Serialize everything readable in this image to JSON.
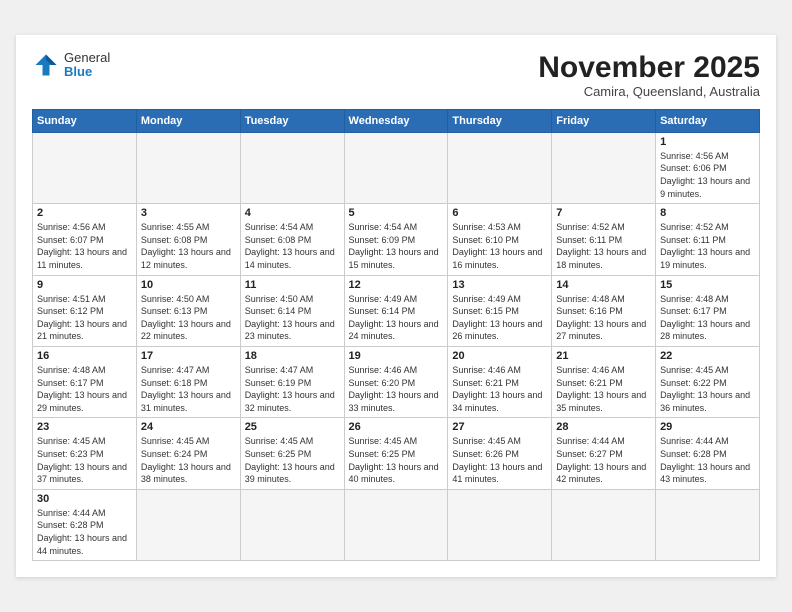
{
  "header": {
    "logo_general": "General",
    "logo_blue": "Blue",
    "month_title": "November 2025",
    "subtitle": "Camira, Queensland, Australia"
  },
  "weekdays": [
    "Sunday",
    "Monday",
    "Tuesday",
    "Wednesday",
    "Thursday",
    "Friday",
    "Saturday"
  ],
  "weeks": [
    [
      {
        "day": "",
        "info": ""
      },
      {
        "day": "",
        "info": ""
      },
      {
        "day": "",
        "info": ""
      },
      {
        "day": "",
        "info": ""
      },
      {
        "day": "",
        "info": ""
      },
      {
        "day": "",
        "info": ""
      },
      {
        "day": "1",
        "info": "Sunrise: 4:56 AM\nSunset: 6:06 PM\nDaylight: 13 hours and 9 minutes."
      }
    ],
    [
      {
        "day": "2",
        "info": "Sunrise: 4:56 AM\nSunset: 6:07 PM\nDaylight: 13 hours and 11 minutes."
      },
      {
        "day": "3",
        "info": "Sunrise: 4:55 AM\nSunset: 6:08 PM\nDaylight: 13 hours and 12 minutes."
      },
      {
        "day": "4",
        "info": "Sunrise: 4:54 AM\nSunset: 6:08 PM\nDaylight: 13 hours and 14 minutes."
      },
      {
        "day": "5",
        "info": "Sunrise: 4:54 AM\nSunset: 6:09 PM\nDaylight: 13 hours and 15 minutes."
      },
      {
        "day": "6",
        "info": "Sunrise: 4:53 AM\nSunset: 6:10 PM\nDaylight: 13 hours and 16 minutes."
      },
      {
        "day": "7",
        "info": "Sunrise: 4:52 AM\nSunset: 6:11 PM\nDaylight: 13 hours and 18 minutes."
      },
      {
        "day": "8",
        "info": "Sunrise: 4:52 AM\nSunset: 6:11 PM\nDaylight: 13 hours and 19 minutes."
      }
    ],
    [
      {
        "day": "9",
        "info": "Sunrise: 4:51 AM\nSunset: 6:12 PM\nDaylight: 13 hours and 21 minutes."
      },
      {
        "day": "10",
        "info": "Sunrise: 4:50 AM\nSunset: 6:13 PM\nDaylight: 13 hours and 22 minutes."
      },
      {
        "day": "11",
        "info": "Sunrise: 4:50 AM\nSunset: 6:14 PM\nDaylight: 13 hours and 23 minutes."
      },
      {
        "day": "12",
        "info": "Sunrise: 4:49 AM\nSunset: 6:14 PM\nDaylight: 13 hours and 24 minutes."
      },
      {
        "day": "13",
        "info": "Sunrise: 4:49 AM\nSunset: 6:15 PM\nDaylight: 13 hours and 26 minutes."
      },
      {
        "day": "14",
        "info": "Sunrise: 4:48 AM\nSunset: 6:16 PM\nDaylight: 13 hours and 27 minutes."
      },
      {
        "day": "15",
        "info": "Sunrise: 4:48 AM\nSunset: 6:17 PM\nDaylight: 13 hours and 28 minutes."
      }
    ],
    [
      {
        "day": "16",
        "info": "Sunrise: 4:48 AM\nSunset: 6:17 PM\nDaylight: 13 hours and 29 minutes."
      },
      {
        "day": "17",
        "info": "Sunrise: 4:47 AM\nSunset: 6:18 PM\nDaylight: 13 hours and 31 minutes."
      },
      {
        "day": "18",
        "info": "Sunrise: 4:47 AM\nSunset: 6:19 PM\nDaylight: 13 hours and 32 minutes."
      },
      {
        "day": "19",
        "info": "Sunrise: 4:46 AM\nSunset: 6:20 PM\nDaylight: 13 hours and 33 minutes."
      },
      {
        "day": "20",
        "info": "Sunrise: 4:46 AM\nSunset: 6:21 PM\nDaylight: 13 hours and 34 minutes."
      },
      {
        "day": "21",
        "info": "Sunrise: 4:46 AM\nSunset: 6:21 PM\nDaylight: 13 hours and 35 minutes."
      },
      {
        "day": "22",
        "info": "Sunrise: 4:45 AM\nSunset: 6:22 PM\nDaylight: 13 hours and 36 minutes."
      }
    ],
    [
      {
        "day": "23",
        "info": "Sunrise: 4:45 AM\nSunset: 6:23 PM\nDaylight: 13 hours and 37 minutes."
      },
      {
        "day": "24",
        "info": "Sunrise: 4:45 AM\nSunset: 6:24 PM\nDaylight: 13 hours and 38 minutes."
      },
      {
        "day": "25",
        "info": "Sunrise: 4:45 AM\nSunset: 6:25 PM\nDaylight: 13 hours and 39 minutes."
      },
      {
        "day": "26",
        "info": "Sunrise: 4:45 AM\nSunset: 6:25 PM\nDaylight: 13 hours and 40 minutes."
      },
      {
        "day": "27",
        "info": "Sunrise: 4:45 AM\nSunset: 6:26 PM\nDaylight: 13 hours and 41 minutes."
      },
      {
        "day": "28",
        "info": "Sunrise: 4:44 AM\nSunset: 6:27 PM\nDaylight: 13 hours and 42 minutes."
      },
      {
        "day": "29",
        "info": "Sunrise: 4:44 AM\nSunset: 6:28 PM\nDaylight: 13 hours and 43 minutes."
      }
    ],
    [
      {
        "day": "30",
        "info": "Sunrise: 4:44 AM\nSunset: 6:28 PM\nDaylight: 13 hours and 44 minutes."
      },
      {
        "day": "",
        "info": ""
      },
      {
        "day": "",
        "info": ""
      },
      {
        "day": "",
        "info": ""
      },
      {
        "day": "",
        "info": ""
      },
      {
        "day": "",
        "info": ""
      },
      {
        "day": "",
        "info": ""
      }
    ]
  ]
}
